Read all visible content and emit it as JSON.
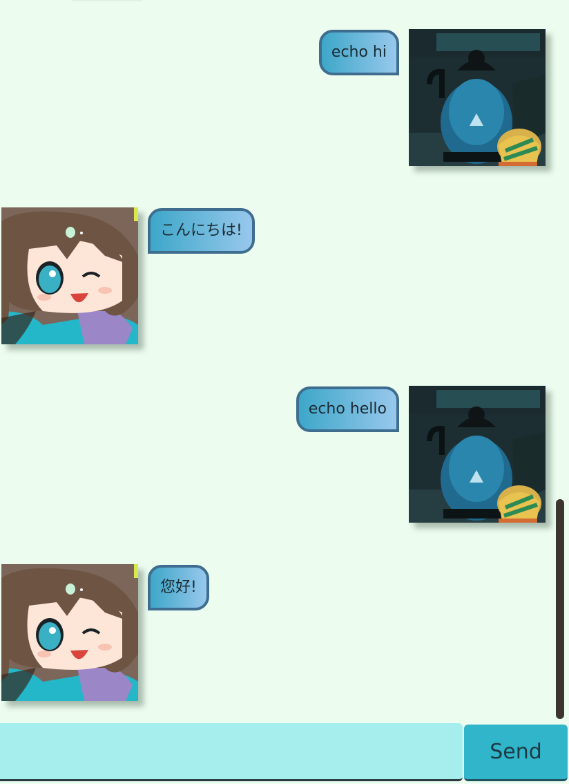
{
  "messages": [
    {
      "sender": "user",
      "text": "echo hi",
      "avatar": "kettle-photo-avatar"
    },
    {
      "sender": "bot",
      "text": "こんにちは!",
      "avatar": "anime-girl-avatar"
    },
    {
      "sender": "user",
      "text": "echo hello",
      "avatar": "kettle-photo-avatar"
    },
    {
      "sender": "bot",
      "text": "您好!",
      "avatar": "anime-girl-avatar"
    }
  ],
  "input": {
    "value": "",
    "placeholder": ""
  },
  "send_label": "Send",
  "colors": {
    "background": "#ecfdf0",
    "bubble_start": "#3ea7c9",
    "bubble_end": "#97c8ec",
    "bubble_border": "#3f6d8f",
    "input_bg": "#a6eeee",
    "send_bg": "#31b5cb",
    "scrollbar": "#3b342f"
  }
}
